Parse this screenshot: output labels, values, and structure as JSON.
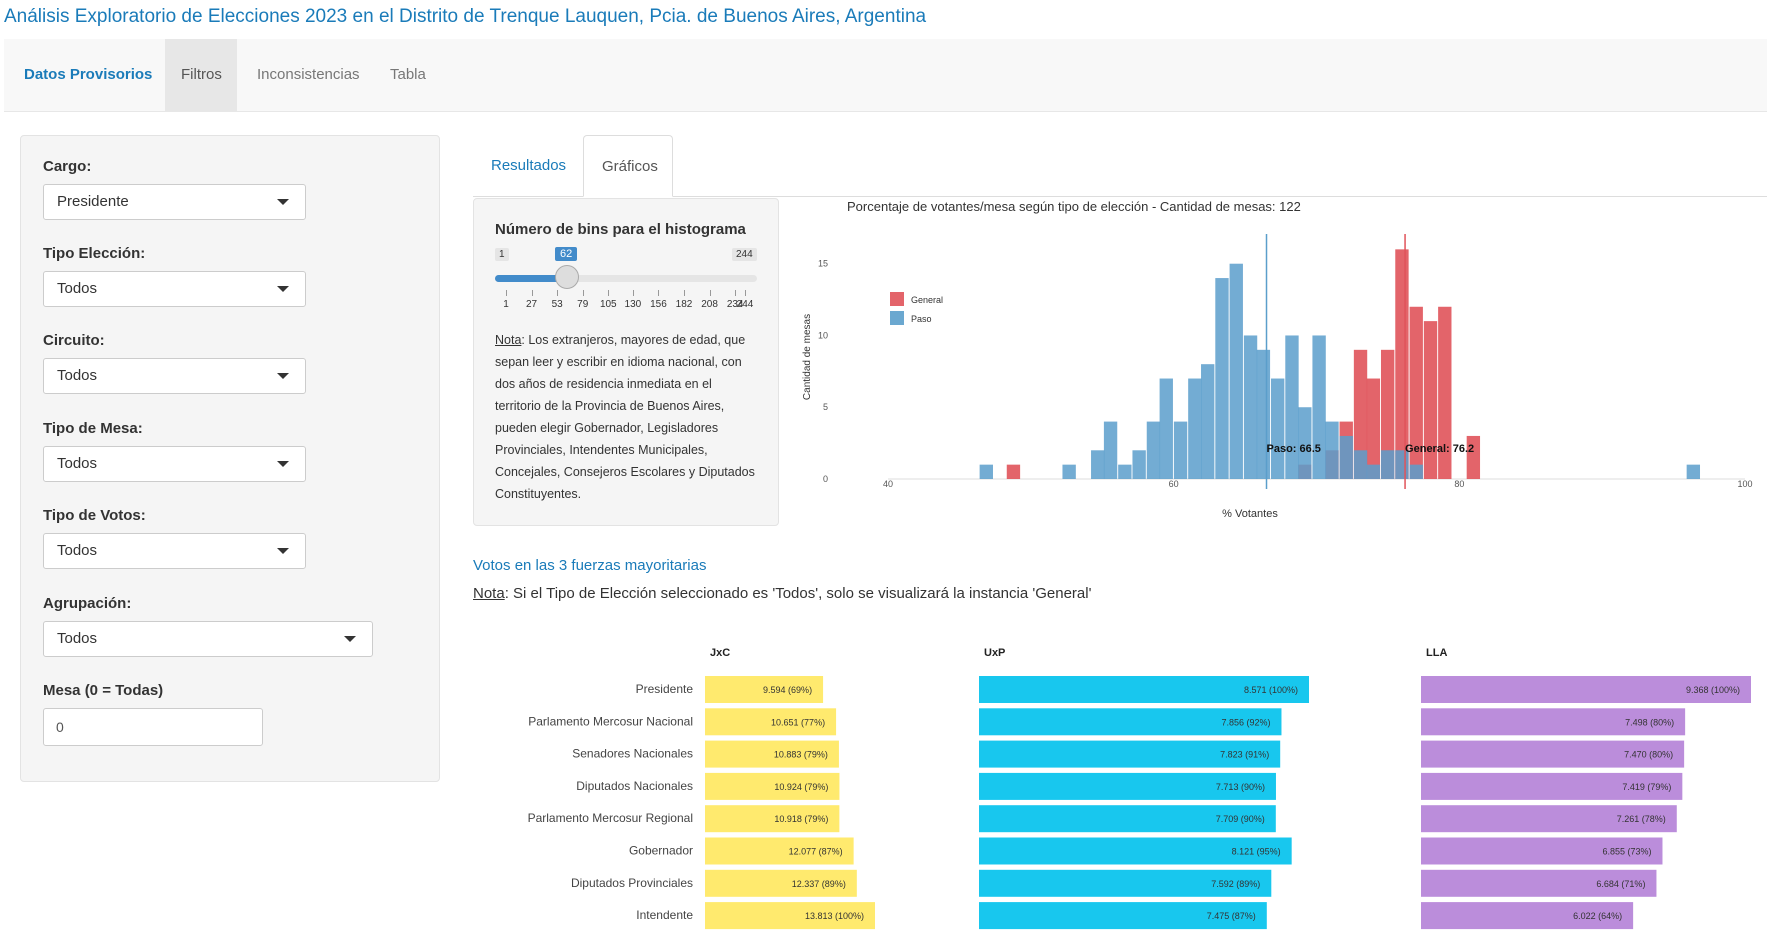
{
  "app": {
    "title": "Análisis Exploratorio de Elecciones 2023 en el Distrito de Trenque Lauquen, Pcia. de Buenos Aires, Argentina"
  },
  "navbar": {
    "brand": "Datos Provisorios",
    "items": [
      {
        "label": "Filtros",
        "active": true
      },
      {
        "label": "Inconsistencias"
      },
      {
        "label": "Tabla"
      }
    ]
  },
  "sidebar": {
    "filters": [
      {
        "label": "Cargo:",
        "value": "Presidente"
      },
      {
        "label": "Tipo Elección:",
        "value": "Todos"
      },
      {
        "label": "Circuito:",
        "value": "Todos"
      },
      {
        "label": "Tipo de Mesa:",
        "value": "Todos"
      },
      {
        "label": "Tipo de Votos:",
        "value": "Todos"
      },
      {
        "label": "Agrupación:",
        "value": "Todos"
      }
    ],
    "mesa": {
      "label": "Mesa (0 = Todas)",
      "value": "0"
    }
  },
  "tabs": [
    {
      "label": "Resultados"
    },
    {
      "label": "Gráficos",
      "active": true
    }
  ],
  "bins": {
    "label": "Número de bins para el histograma",
    "min": "1",
    "max": "244",
    "value": "62",
    "tick_labels": [
      "1",
      "27",
      "53",
      "79",
      "105",
      "130",
      "156",
      "182",
      "208",
      "234",
      "244"
    ],
    "note_label": "Nota",
    "note_text": ": Los extranjeros, mayores de edad, que sepan leer y escribir en idioma nacional, con dos años de residencia inmediata en el territorio de la Provincia de Buenos Aires, pueden elegir Gobernador, Legisladores Provinciales, Intendentes Municipales, Concejales, Consejeros Escolares y Diputados Constituyentes."
  },
  "votos": {
    "title": "Votos en las 3 fuerzas mayoritarias",
    "note_label": "Nota",
    "note_text": ": Si el Tipo de Elección seleccionado es 'Todos', solo se visualizará la instancia 'General'"
  },
  "colors": {
    "accent": "#1a7bb9",
    "general": "#e0535a",
    "paso": "#5b9ecb",
    "jxc": "#ffea6e",
    "uxp": "#18c7ee",
    "lla": "#bb8ddb"
  },
  "chart_data": [
    {
      "type": "bar",
      "title": "Porcentaje de votantes/mesa según tipo de elección - Cantidad de mesas: 122",
      "xlabel": "% Votantes",
      "ylabel": "Cantidad de mesas",
      "xlim": [
        40,
        100
      ],
      "ylim": [
        0,
        17
      ],
      "xticks": [
        40,
        60,
        80,
        100
      ],
      "yticks": [
        0,
        5,
        10,
        15
      ],
      "legend_position": "top-left",
      "bin_width": 0.97,
      "series": [
        {
          "name": "General",
          "x": [
            48.8,
            69.2,
            71.1,
            72.1,
            73.1,
            74.0,
            75.0,
            76.0,
            77.0,
            78.0,
            79.0,
            81.0
          ],
          "values": [
            1,
            1,
            2,
            4,
            9,
            7,
            9,
            16,
            12,
            11,
            12,
            3
          ]
        },
        {
          "name": "Paso",
          "x": [
            46.9,
            52.7,
            54.7,
            55.6,
            56.6,
            57.6,
            58.6,
            59.5,
            60.5,
            61.5,
            62.4,
            63.4,
            64.4,
            65.4,
            66.3,
            67.3,
            68.3,
            69.2,
            70.2,
            71.1,
            72.1,
            73.1,
            74.0,
            75.0,
            76.0,
            77.0,
            96.4
          ],
          "values": [
            1,
            1,
            2,
            4,
            1,
            2,
            4,
            7,
            4,
            7,
            8,
            14,
            15,
            10,
            9,
            7,
            10,
            5,
            10,
            4,
            3,
            2,
            1,
            2,
            2,
            1,
            1
          ]
        }
      ],
      "annotations": [
        {
          "text": "Paso: 66.5",
          "x": 66.5
        },
        {
          "text": "General: 76.2",
          "x": 76.2
        }
      ]
    },
    {
      "type": "bar",
      "orientation": "horizontal",
      "categories": [
        "Presidente",
        "Parlamento Mercosur Nacional",
        "Senadores Nacionales",
        "Diputados Nacionales",
        "Parlamento Mercosur Regional",
        "Gobernador",
        "Diputados Provinciales",
        "Intendente"
      ],
      "series": [
        {
          "name": "JxC",
          "values": [
            9594,
            10651,
            10883,
            10924,
            10918,
            12077,
            12337,
            13813
          ],
          "labels": [
            "9.594 (69%)",
            "10.651 (77%)",
            "10.883 (79%)",
            "10.924 (79%)",
            "10.918 (79%)",
            "12.077 (87%)",
            "12.337 (89%)",
            "13.813 (100%)"
          ]
        },
        {
          "name": "UxP",
          "values": [
            8571,
            7856,
            7823,
            7713,
            7709,
            8121,
            7592,
            7475
          ],
          "labels": [
            "8.571 (100%)",
            "7.856 (92%)",
            "7.823 (91%)",
            "7.713 (90%)",
            "7.709 (90%)",
            "8.121 (95%)",
            "7.592 (89%)",
            "7.475 (87%)"
          ]
        },
        {
          "name": "LLA",
          "values": [
            9368,
            7498,
            7470,
            7419,
            7261,
            6855,
            6684,
            6022
          ],
          "labels": [
            "9.368 (100%)",
            "7.498 (80%)",
            "7.470 (80%)",
            "7.419 (79%)",
            "7.261 (78%)",
            "6.855 (73%)",
            "6.684 (71%)",
            "6.022 (64%)"
          ]
        }
      ]
    }
  ]
}
